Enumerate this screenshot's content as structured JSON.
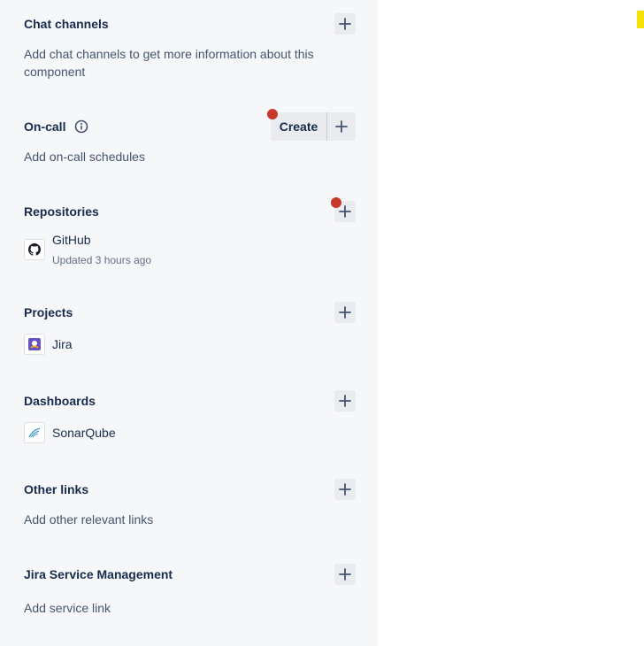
{
  "sections": {
    "chat_channels": {
      "title": "Chat channels",
      "description": "Add chat channels to get more information about this component"
    },
    "on_call": {
      "title": "On-call",
      "create_label": "Create",
      "description": "Add on-call schedules"
    },
    "repositories": {
      "title": "Repositories",
      "items": [
        {
          "name": "GitHub",
          "meta": "Updated 3 hours ago",
          "icon": "github-icon"
        }
      ]
    },
    "projects": {
      "title": "Projects",
      "items": [
        {
          "name": "Jira",
          "icon": "jira-project-icon"
        }
      ]
    },
    "dashboards": {
      "title": "Dashboards",
      "items": [
        {
          "name": "SonarQube",
          "icon": "sonarqube-icon"
        }
      ]
    },
    "other_links": {
      "title": "Other links",
      "description": "Add other relevant links"
    },
    "jsm": {
      "title": "Jira Service Management",
      "description": "Add service link"
    }
  },
  "colors": {
    "panel_bg": "#f6f7f9",
    "notification_dot": "#c9372c",
    "button_bg": "#e9ebee",
    "accent_mark": "#f5e20a"
  }
}
